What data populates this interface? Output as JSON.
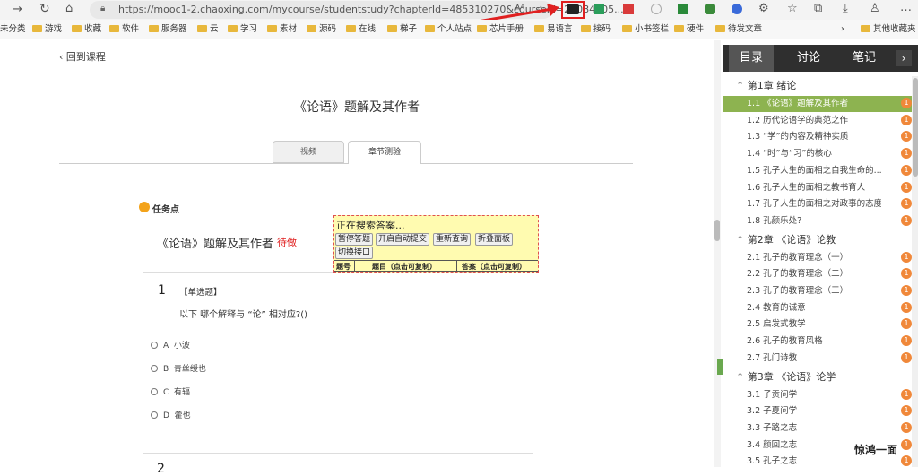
{
  "browser": {
    "url": "https://mooc1-2.chaoxing.com/mycourse/studentstudy?chapterId=485310270&courseId=22084805...",
    "bookmarks": [
      "未分类",
      "游戏",
      "收藏",
      "软件",
      "服务器",
      "云",
      "学习",
      "素材",
      "源码",
      "在线",
      "梯子",
      "个人站点",
      "芯片手册",
      "易语言",
      "接码",
      "小书签栏",
      "硬件",
      "待发文章",
      "其他收藏夹"
    ]
  },
  "nav": {
    "back_label": "回到课程"
  },
  "page": {
    "title": "《论语》题解及其作者",
    "tabs": [
      "视频",
      "章节测验"
    ],
    "task_point_label": "任务点",
    "quiz_title": "《论语》题解及其作者",
    "quiz_status": "待做"
  },
  "search_panel": {
    "status": "正在搜索答案...",
    "buttons": [
      "暂停答题",
      "开启自动提交",
      "重新查询",
      "折叠面板",
      "切换接口"
    ],
    "columns": [
      "题号",
      "题目（点击可复制）",
      "答案（点击可复制）"
    ]
  },
  "question": {
    "number": "1",
    "type": "【单选题】",
    "text": "以下 哪个解释与 “论” 相对应?()",
    "options": [
      {
        "key": "A",
        "text": "小波"
      },
      {
        "key": "B",
        "text": "青丝绶也"
      },
      {
        "key": "C",
        "text": "有辐"
      },
      {
        "key": "D",
        "text": "藿也"
      }
    ]
  },
  "sidebar": {
    "tabs": [
      "目录",
      "讨论",
      "笔记"
    ],
    "chapters": [
      {
        "title": "第1章 绪论",
        "items": [
          "1.1 《论语》题解及其作者",
          "1.2 历代论语学的典范之作",
          "1.3 “学”的内容及精神实质",
          "1.4 “时”与“习”的核心",
          "1.5 孔子人生的面相之自我生命的...",
          "1.6 孔子人生的面相之教书育人",
          "1.7 孔子人生的面相之对政事的态度",
          "1.8 孔颜乐处?"
        ]
      },
      {
        "title": "第2章 《论语》论教",
        "items": [
          "2.1 孔子的教育理念（一）",
          "2.2 孔子的教育理念（二）",
          "2.3 孔子的教育理念（三）",
          "2.4 教育的诚意",
          "2.5 启发式教学",
          "2.6 孔子的教育风格",
          "2.7 孔门诗教"
        ]
      },
      {
        "title": "第3章 《论语》论学",
        "items": [
          "3.1 子贡问学",
          "3.2 子夏问学",
          "3.3 子路之志",
          "3.4 颜回之志",
          "3.5 孔子之志"
        ]
      }
    ],
    "badge": "1",
    "watermark": "惊鸿一面"
  },
  "colors": {
    "active_item": "#8db350",
    "badge": "#f0883a",
    "panel_bg": "#fffbb0",
    "status_red": "#e02020"
  }
}
